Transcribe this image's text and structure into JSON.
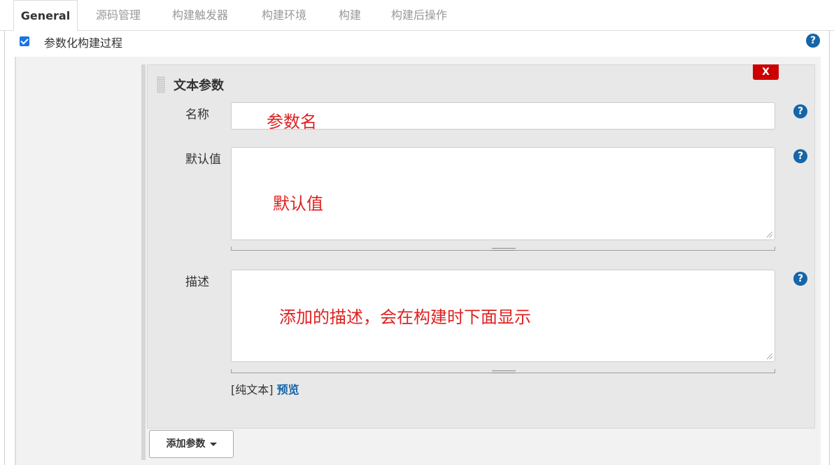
{
  "tabs": [
    {
      "label": "General",
      "active": true
    },
    {
      "label": "源码管理",
      "active": false
    },
    {
      "label": "构建触发器",
      "active": false
    },
    {
      "label": "构建环境",
      "active": false
    },
    {
      "label": "构建",
      "active": false
    },
    {
      "label": "构建后操作",
      "active": false
    }
  ],
  "section": {
    "checkbox_checked": true,
    "label": "参数化构建过程",
    "help_glyph": "?"
  },
  "param": {
    "title": "文本参数",
    "delete_label": "X",
    "fields": {
      "name_label": "名称",
      "name_value": "参数名",
      "default_label": "默认值",
      "default_value": "默认值",
      "desc_label": "描述",
      "desc_value": "添加的描述，会在构建时下面显示"
    },
    "markup": {
      "prefix": "[纯文本]",
      "preview": "预览"
    }
  },
  "add_button": {
    "label": "添加参数",
    "icon": "caret-down-icon"
  },
  "colors": {
    "accent": "#1565a8",
    "annotation_red": "#e02020",
    "delete_red": "#cc0000",
    "panel_bg": "#f2f2f2"
  }
}
